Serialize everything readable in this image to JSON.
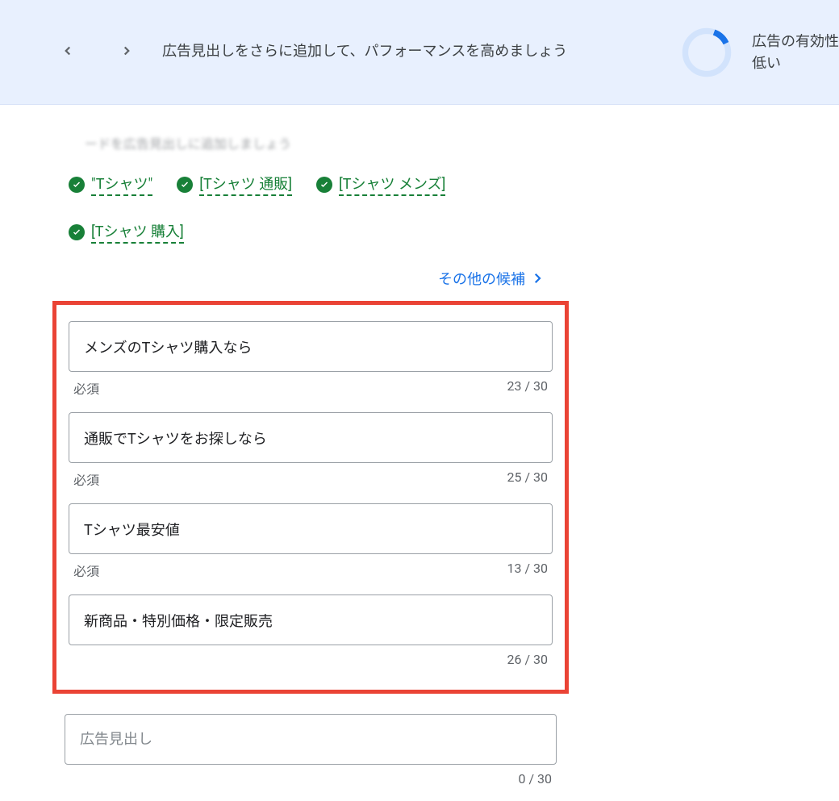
{
  "banner": {
    "text": "広告見出しをさらに追加して、パフォーマンスを高めましょう",
    "effectiveness_label": "広告の有効性",
    "effectiveness_level": "低い"
  },
  "hint": "ードを広告見出しに追加しましょう",
  "keywords": [
    "\"Tシャツ\"",
    "[Tシャツ 通販]",
    "[Tシャツ メンズ]",
    "[Tシャツ 購入]"
  ],
  "more_candidates": "その他の候補",
  "headlines": [
    {
      "value": "メンズのTシャツ購入なら",
      "required": "必須",
      "count": "23 / 30"
    },
    {
      "value": "通販でTシャツをお探しなら",
      "required": "必須",
      "count": "25 / 30"
    },
    {
      "value": "Tシャツ最安値",
      "required": "必須",
      "count": "13 / 30"
    },
    {
      "value": "新商品・特別価格・限定販売",
      "required": "",
      "count": "26 / 30"
    }
  ],
  "extra_headline": {
    "placeholder": "広告見出し",
    "count": "0 / 30"
  }
}
